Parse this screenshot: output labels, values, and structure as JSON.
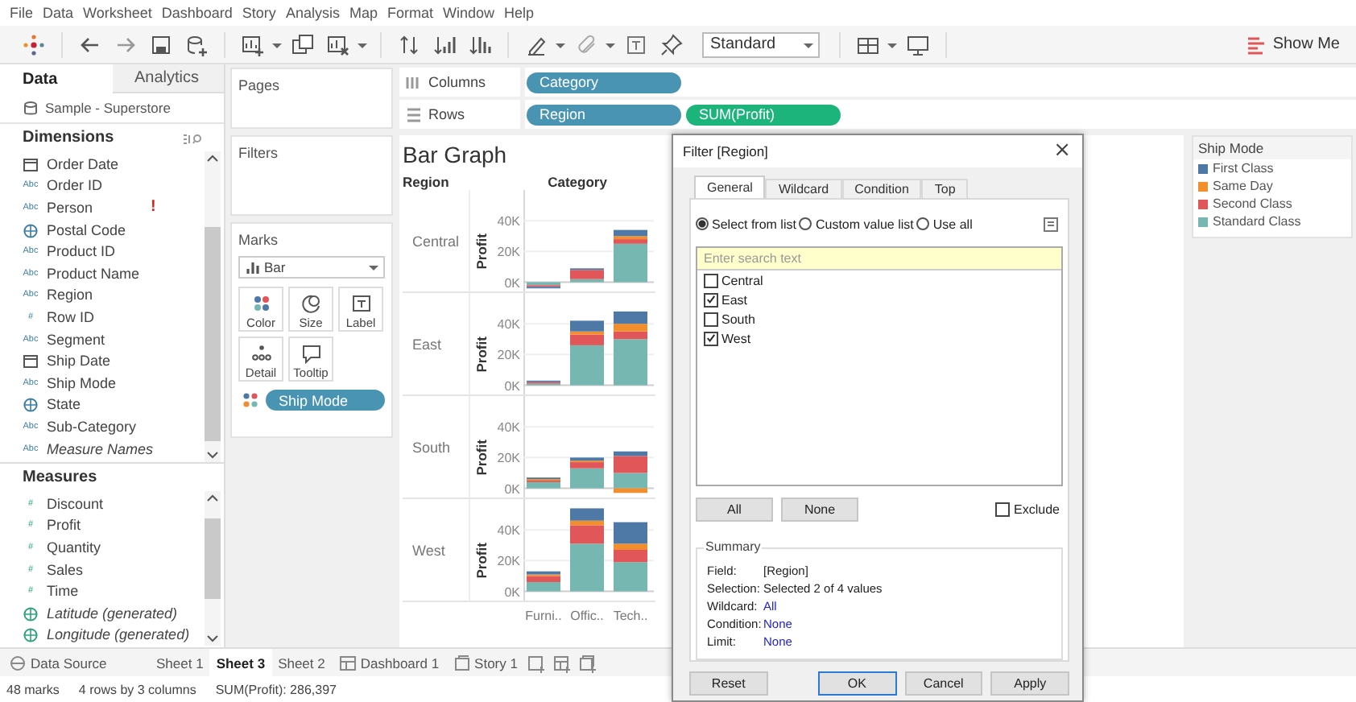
{
  "menu": [
    "File",
    "Data",
    "Worksheet",
    "Dashboard",
    "Story",
    "Analysis",
    "Map",
    "Format",
    "Window",
    "Help"
  ],
  "toolbar": {
    "view_size": "Standard",
    "show_me": "Show Me"
  },
  "data_pane": {
    "tabs": [
      {
        "label": "Data",
        "selected": true
      },
      {
        "label": "Analytics",
        "selected": false
      }
    ],
    "data_source": "Sample - Superstore",
    "dimensions": {
      "title": "Dimensions",
      "fields": [
        {
          "name": "Order Date",
          "kind": "date",
          "italic": false
        },
        {
          "name": "Order ID",
          "kind": "string",
          "icon_text": "Abc",
          "italic": false
        },
        {
          "name": "Person",
          "kind": "string",
          "icon_text": "Abc",
          "italic": false,
          "badge": "!"
        },
        {
          "name": "Postal Code",
          "kind": "geo",
          "italic": false
        },
        {
          "name": "Product ID",
          "kind": "string",
          "icon_text": "Abc",
          "italic": false
        },
        {
          "name": "Product Name",
          "kind": "string",
          "icon_text": "Abc",
          "italic": false
        },
        {
          "name": "Region",
          "kind": "string",
          "icon_text": "Abc",
          "italic": false
        },
        {
          "name": "Row ID",
          "kind": "number",
          "icon_text": "#",
          "italic": false
        },
        {
          "name": "Segment",
          "kind": "string",
          "icon_text": "Abc",
          "italic": false
        },
        {
          "name": "Ship Date",
          "kind": "date",
          "italic": false
        },
        {
          "name": "Ship Mode",
          "kind": "string",
          "icon_text": "Abc",
          "italic": false
        },
        {
          "name": "State",
          "kind": "geo",
          "italic": false
        },
        {
          "name": "Sub-Category",
          "kind": "string",
          "icon_text": "Abc",
          "italic": false
        },
        {
          "name": "Measure Names",
          "kind": "string",
          "icon_text": "Abc",
          "italic": true
        }
      ]
    },
    "measures": {
      "title": "Measures",
      "fields": [
        {
          "name": "Discount",
          "kind": "number",
          "icon_text": "#",
          "italic": false
        },
        {
          "name": "Profit",
          "kind": "number",
          "icon_text": "#",
          "italic": false
        },
        {
          "name": "Quantity",
          "kind": "number",
          "icon_text": "#",
          "italic": false
        },
        {
          "name": "Sales",
          "kind": "number",
          "icon_text": "#",
          "italic": false
        },
        {
          "name": "Time",
          "kind": "number",
          "icon_text": "#",
          "italic": false
        },
        {
          "name": "Latitude (generated)",
          "kind": "geo",
          "italic": true
        },
        {
          "name": "Longitude (generated)",
          "kind": "geo",
          "italic": true
        }
      ]
    }
  },
  "cards": {
    "pages": "Pages",
    "filters": "Filters",
    "marks": {
      "title": "Marks",
      "mark_type": "Bar",
      "buttons": [
        {
          "label": "Color",
          "kind": "color"
        },
        {
          "label": "Size",
          "kind": "size"
        },
        {
          "label": "Label",
          "kind": "label"
        },
        {
          "label": "Detail",
          "kind": "detail"
        },
        {
          "label": "Tooltip",
          "kind": "tooltip"
        }
      ],
      "pills": [
        {
          "label": "Ship Mode",
          "kind": "color"
        }
      ]
    }
  },
  "shelves": [
    {
      "label": "Columns",
      "kind": "columns",
      "pills": [
        {
          "label": "Category",
          "kind": "dimension"
        }
      ]
    },
    {
      "label": "Rows",
      "kind": "rows",
      "pills": [
        {
          "label": "Region",
          "kind": "dimension"
        },
        {
          "label": "SUM(Profit)",
          "kind": "measure"
        }
      ]
    }
  ],
  "worksheet": {
    "title": "Bar Graph",
    "row_header": "Region",
    "column_header": "Category",
    "category_labels": [
      "Furni..",
      "Offic..",
      "Tech.."
    ],
    "panels": [
      {
        "region": "Central",
        "chart_data": {
          "type": "bar",
          "stacked": true,
          "ylabel": "Profit",
          "ylim": [
            -6000,
            60000
          ],
          "yticks": [
            {
              "value": 0,
              "label": "0K"
            },
            {
              "value": 20000,
              "label": "20K"
            },
            {
              "value": 40000,
              "label": "40K"
            }
          ],
          "series": [
            {
              "color": "#76b7b2",
              "values": [
                -2000,
                2000,
                25000
              ]
            },
            {
              "color": "#e15759",
              "values": [
                -1000,
                6000,
                3000
              ]
            },
            {
              "color": "#f28e2b",
              "values": [
                0,
                0,
                2000
              ]
            },
            {
              "color": "#4e79a7",
              "values": [
                -1000,
                1000,
                4000
              ]
            }
          ]
        }
      },
      {
        "region": "East",
        "chart_data": {
          "type": "bar",
          "stacked": true,
          "ylabel": "Profit",
          "ylim": [
            -6000,
            60000
          ],
          "yticks": [
            {
              "value": 0,
              "label": "0K"
            },
            {
              "value": 20000,
              "label": "20K"
            },
            {
              "value": 40000,
              "label": "40K"
            }
          ],
          "series": [
            {
              "color": "#76b7b2",
              "values": [
                1000,
                26000,
                30000
              ]
            },
            {
              "color": "#e15759",
              "values": [
                1000,
                7000,
                5000
              ]
            },
            {
              "color": "#f28e2b",
              "values": [
                0,
                2000,
                5000
              ]
            },
            {
              "color": "#4e79a7",
              "values": [
                1000,
                7000,
                8000
              ]
            }
          ]
        }
      },
      {
        "region": "South",
        "chart_data": {
          "type": "bar",
          "stacked": true,
          "ylabel": "Profit",
          "ylim": [
            -6000,
            60000
          ],
          "yticks": [
            {
              "value": 0,
              "label": "0K"
            },
            {
              "value": 20000,
              "label": "20K"
            },
            {
              "value": 40000,
              "label": "40K"
            }
          ],
          "series": [
            {
              "color": "#76b7b2",
              "values": [
                4000,
                13000,
                10000
              ]
            },
            {
              "color": "#e15759",
              "values": [
                1000,
                4000,
                11000
              ]
            },
            {
              "color": "#f28e2b",
              "values": [
                1000,
                1000,
                -3000
              ]
            },
            {
              "color": "#4e79a7",
              "values": [
                1000,
                2000,
                3000
              ]
            }
          ]
        }
      },
      {
        "region": "West",
        "chart_data": {
          "type": "bar",
          "stacked": true,
          "ylabel": "Profit",
          "ylim": [
            -6000,
            60000
          ],
          "yticks": [
            {
              "value": 0,
              "label": "0K"
            },
            {
              "value": 20000,
              "label": "20K"
            },
            {
              "value": 40000,
              "label": "40K"
            }
          ],
          "series": [
            {
              "color": "#76b7b2",
              "values": [
                6000,
                31000,
                19000
              ]
            },
            {
              "color": "#e15759",
              "values": [
                4000,
                12000,
                8000
              ]
            },
            {
              "color": "#f28e2b",
              "values": [
                1000,
                3000,
                4000
              ]
            },
            {
              "color": "#4e79a7",
              "values": [
                2000,
                8000,
                14000
              ]
            }
          ]
        }
      }
    ]
  },
  "legend": {
    "title": "Ship Mode",
    "items": [
      {
        "label": "First Class",
        "color": "#4e79a7"
      },
      {
        "label": "Same Day",
        "color": "#f28e2b"
      },
      {
        "label": "Second Class",
        "color": "#e15759"
      },
      {
        "label": "Standard Class",
        "color": "#76b7b2"
      }
    ]
  },
  "filter_dialog": {
    "title": "Filter [Region]",
    "close": "×",
    "tabs": [
      {
        "label": "General",
        "selected": true
      },
      {
        "label": "Wildcard",
        "selected": false
      },
      {
        "label": "Condition",
        "selected": false
      },
      {
        "label": "Top",
        "selected": false
      }
    ],
    "modes": [
      {
        "label": "Select from list",
        "selected": true
      },
      {
        "label": "Custom value list",
        "selected": false
      },
      {
        "label": "Use all",
        "selected": false
      }
    ],
    "search": {
      "placeholder": "Enter search text"
    },
    "values": [
      {
        "label": "Central",
        "checked": false
      },
      {
        "label": "East",
        "checked": true
      },
      {
        "label": "South",
        "checked": false
      },
      {
        "label": "West",
        "checked": true
      }
    ],
    "select_buttons": [
      "All",
      "None"
    ],
    "exclude": {
      "label": "Exclude",
      "checked": false
    },
    "summary": {
      "title": "Summary",
      "rows": [
        {
          "label": "Field:",
          "value": "[Region]",
          "link": false
        },
        {
          "label": "Selection:",
          "value": "Selected 2 of 4 values",
          "link": false
        },
        {
          "label": "Wildcard:",
          "value": "All",
          "link": true
        },
        {
          "label": "Condition:",
          "value": "None",
          "link": true
        },
        {
          "label": "Limit:",
          "value": "None",
          "link": true
        }
      ]
    },
    "buttons": [
      {
        "label": "Reset",
        "default": false
      },
      {
        "label": "OK",
        "default": true
      },
      {
        "label": "Cancel",
        "default": false
      },
      {
        "label": "Apply",
        "default": false
      }
    ]
  },
  "sheet_tabs": [
    {
      "label": "Data Source",
      "kind": "data_source",
      "selected": false
    },
    {
      "label": "Sheet 1",
      "kind": "sheet",
      "selected": false
    },
    {
      "label": "Sheet 3",
      "kind": "sheet",
      "selected": true
    },
    {
      "label": "Sheet 2",
      "kind": "sheet",
      "selected": false
    },
    {
      "label": "Dashboard 1",
      "kind": "dashboard",
      "selected": false
    },
    {
      "label": "Story 1",
      "kind": "story",
      "selected": false
    }
  ],
  "status_bar": [
    "48 marks",
    "4 rows by 3 columns",
    "SUM(Profit): 286,397"
  ]
}
